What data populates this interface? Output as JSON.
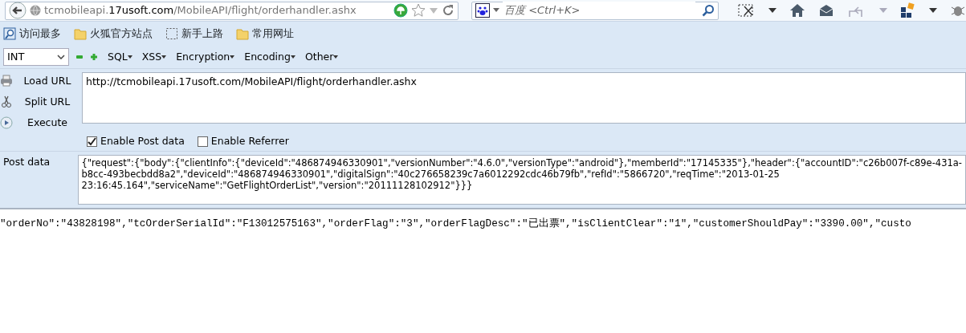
{
  "address_bar": {
    "url": {
      "subdomain": "tcmobileapi.",
      "domain": "17usoft.com",
      "path": "/MobileAPI/flight/orderhandler.ashx"
    }
  },
  "search": {
    "placeholder": "百度 <Ctrl+K>"
  },
  "bookmarks": [
    {
      "label": "访问最多",
      "kind": "search"
    },
    {
      "label": "火狐官方站点",
      "kind": "folder"
    },
    {
      "label": "新手上路",
      "kind": "page"
    },
    {
      "label": "常用网址",
      "kind": "folder"
    }
  ],
  "hackbar": {
    "select": {
      "value": "INT"
    },
    "menus": [
      "SQL",
      "XSS",
      "Encryption",
      "Encoding",
      "Other"
    ],
    "actions": [
      {
        "label": "Load URL",
        "kind": "load"
      },
      {
        "label": "Split URL",
        "kind": "split"
      },
      {
        "label": "Execute",
        "kind": "execute"
      }
    ],
    "url_field": {
      "value": "http://tcmobileapi.17usoft.com/MobileAPI/flight/orderhandler.ashx"
    },
    "options": [
      {
        "label": "Enable Post data",
        "checked": true
      },
      {
        "label": "Enable Referrer",
        "checked": false
      }
    ],
    "post_data": {
      "label": "Post data",
      "lines": [
        "{\"request\":{\"body\":{\"clientInfo\":{\"deviceId\":\"486874946330901\",\"versionNumber\":\"4.6.0\",\"versionType\":\"android\"},\"memberId\":\"17145335\"},\"header\":{\"accountID\":\"c26b007f-c89e-431a-",
        "b8cc-493becbdd8a2\",\"deviceId\":\"486874946330901\",\"digitalSign\":\"40c276658239c7a6012292cdc46b79fb\",\"refId\":\"5866720\",\"reqTime\":\"2013-01-25",
        "23:16:45.164\",\"serviceName\":\"GetFlightOrderList\",\"version\":\"20111128102912\"}}}"
      ]
    }
  },
  "response": {
    "text": "\"orderNo\":\"43828198\",\"tcOrderSerialId\":\"F13012575163\",\"orderFlag\":\"3\",\"orderFlagDesc\":\"已出票\",\"isClientClear\":\"1\",\"customerShouldPay\":\"3390.00\",\"custo"
  }
}
